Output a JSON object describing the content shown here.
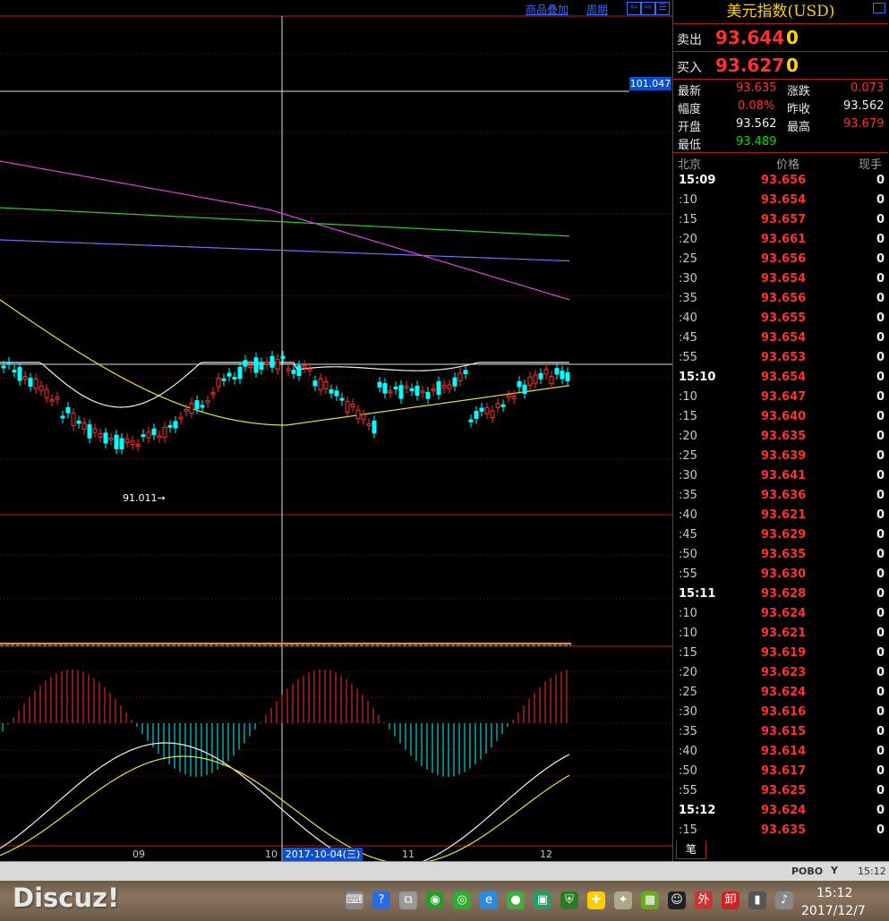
{
  "toolbar": {
    "overlay_label": "商品叠加",
    "period_label": "周期",
    "nav_left": "⇦",
    "nav_right": "⇨",
    "nav_menu": "☰"
  },
  "chart": {
    "price_tag": "101.047",
    "low_label": "91.011→",
    "x_labels": [
      "09",
      "10",
      "11",
      "12"
    ],
    "date_tag": "2017-10-04(三)"
  },
  "quote": {
    "title": "美元指数(USD)",
    "sell_label": "卖出",
    "sell_price": "93.644",
    "sell_vol": "0",
    "buy_label": "买入",
    "buy_price": "93.627",
    "buy_vol": "0",
    "stats": {
      "latest_label": "最新",
      "latest": "93.635",
      "change_label": "涨跌",
      "change": "0.073",
      "pct_label": "幅度",
      "pct": "0.08%",
      "prev_label": "昨收",
      "prev": "93.562",
      "open_label": "开盘",
      "open": "93.562",
      "high_label": "最高",
      "high": "93.679",
      "low_label": "最低",
      "low": "93.489"
    },
    "ticks_header": {
      "time": "北京",
      "price": "价格",
      "vol": "现手"
    },
    "ticks": [
      {
        "time": "15:09",
        "price": "93.656",
        "vol": "0",
        "major": true
      },
      {
        "time": ":10",
        "price": "93.654",
        "vol": "0"
      },
      {
        "time": ":15",
        "price": "93.657",
        "vol": "0"
      },
      {
        "time": ":20",
        "price": "93.661",
        "vol": "0"
      },
      {
        "time": ":25",
        "price": "93.656",
        "vol": "0"
      },
      {
        "time": ":30",
        "price": "93.654",
        "vol": "0"
      },
      {
        "time": ":35",
        "price": "93.656",
        "vol": "0"
      },
      {
        "time": ":40",
        "price": "93.655",
        "vol": "0"
      },
      {
        "time": ":45",
        "price": "93.654",
        "vol": "0"
      },
      {
        "time": ":55",
        "price": "93.653",
        "vol": "0"
      },
      {
        "time": "15:10",
        "price": "93.654",
        "vol": "0",
        "major": true
      },
      {
        "time": ":10",
        "price": "93.647",
        "vol": "0"
      },
      {
        "time": ":15",
        "price": "93.640",
        "vol": "0"
      },
      {
        "time": ":20",
        "price": "93.635",
        "vol": "0"
      },
      {
        "time": ":25",
        "price": "93.639",
        "vol": "0"
      },
      {
        "time": ":30",
        "price": "93.641",
        "vol": "0"
      },
      {
        "time": ":35",
        "price": "93.636",
        "vol": "0"
      },
      {
        "time": ":40",
        "price": "93.621",
        "vol": "0"
      },
      {
        "time": ":45",
        "price": "93.629",
        "vol": "0"
      },
      {
        "time": ":50",
        "price": "93.635",
        "vol": "0"
      },
      {
        "time": ":55",
        "price": "93.630",
        "vol": "0"
      },
      {
        "time": "15:11",
        "price": "93.628",
        "vol": "0",
        "major": true
      },
      {
        "time": ":10",
        "price": "93.624",
        "vol": "0"
      },
      {
        "time": ":10",
        "price": "93.621",
        "vol": "0"
      },
      {
        "time": ":15",
        "price": "93.619",
        "vol": "0"
      },
      {
        "time": ":20",
        "price": "93.623",
        "vol": "0"
      },
      {
        "time": ":25",
        "price": "93.624",
        "vol": "0"
      },
      {
        "time": ":30",
        "price": "93.616",
        "vol": "0"
      },
      {
        "time": ":35",
        "price": "93.615",
        "vol": "0"
      },
      {
        "time": ":40",
        "price": "93.614",
        "vol": "0"
      },
      {
        "time": ":50",
        "price": "93.617",
        "vol": "0"
      },
      {
        "time": ":55",
        "price": "93.625",
        "vol": "0"
      },
      {
        "time": "15:12",
        "price": "93.624",
        "vol": "0",
        "major": true
      },
      {
        "time": ":15",
        "price": "93.635",
        "vol": "0"
      }
    ],
    "tab_label": "笔"
  },
  "statusbar": {
    "brand": "POBO",
    "time": "15:12"
  },
  "taskbar": {
    "watermark": "Discuz!",
    "clock_time": "15:12",
    "clock_date": "2017/12/7",
    "tray_icons": [
      "keyboard-icon",
      "help-icon",
      "window-icon",
      "wifi-app-icon",
      "wechat-icon",
      "browser-icon",
      "ball-icon",
      "app-icon",
      "shield-icon",
      "game-icon",
      "tools-icon",
      "nvidia-icon",
      "qq-icon",
      "waibao-icon",
      "china-icon",
      "signal-icon",
      "volume-icon"
    ]
  },
  "colors": {
    "panel_border": "#b02020",
    "up": "#ff3030",
    "down": "#00ffff",
    "accent": "#ffd200"
  }
}
